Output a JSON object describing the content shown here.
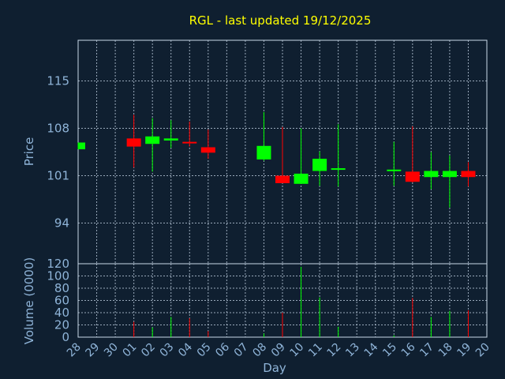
{
  "chart_data": {
    "type": "candlestick",
    "title": "RGL - last updated 19/12/2025",
    "xlabel": "Day",
    "ylabel_price": "Price",
    "ylabel_volume": "Volume (0000)",
    "x_tick_labels": [
      "28",
      "29",
      "30",
      "01",
      "02",
      "03",
      "04",
      "05",
      "06",
      "07",
      "08",
      "09",
      "10",
      "11",
      "12",
      "13",
      "14",
      "15",
      "16",
      "17",
      "18",
      "19",
      "20"
    ],
    "price_ticks": [
      "115",
      "108",
      "101",
      "94"
    ],
    "volume_ticks": [
      "0",
      "20",
      "40",
      "60",
      "80",
      "100",
      "120"
    ],
    "price_ylim": [
      88,
      121
    ],
    "volume_ylim": [
      0,
      120
    ],
    "grid": true,
    "colors": {
      "up": "#00ff00",
      "down": "#ff0000",
      "title": "#ffff00",
      "ticks": "#8fb4d8",
      "background": "#0f1f30"
    },
    "candles": [
      {
        "x": "28",
        "open": 104.9,
        "close": 105.9,
        "high": 105.9,
        "low": 104.9
      },
      {
        "x": "01",
        "open": 106.5,
        "close": 105.3,
        "high": 110.0,
        "low": 102.2
      },
      {
        "x": "02",
        "open": 105.7,
        "close": 106.8,
        "high": 109.5,
        "low": 101.6
      },
      {
        "x": "03",
        "open": 106.2,
        "close": 106.5,
        "high": 109.2,
        "low": 105.1
      },
      {
        "x": "04",
        "open": 106.0,
        "close": 105.8,
        "high": 109.0,
        "low": 105.3
      },
      {
        "x": "05",
        "open": 105.2,
        "close": 104.4,
        "high": 107.8,
        "low": 103.5
      },
      {
        "x": "08",
        "open": 103.4,
        "close": 105.4,
        "high": 110.4,
        "low": 103.2
      },
      {
        "x": "09",
        "open": 101.0,
        "close": 99.9,
        "high": 108.2,
        "low": 99.9
      },
      {
        "x": "10",
        "open": 99.8,
        "close": 101.3,
        "high": 108.0,
        "low": 99.8
      },
      {
        "x": "11",
        "open": 101.7,
        "close": 103.5,
        "high": 104.6,
        "low": 99.5
      },
      {
        "x": "12",
        "open": 101.9,
        "close": 102.1,
        "high": 108.6,
        "low": 99.4
      },
      {
        "x": "15",
        "open": 101.7,
        "close": 101.9,
        "high": 106.0,
        "low": 99.5
      },
      {
        "x": "16",
        "open": 101.6,
        "close": 100.1,
        "high": 108.3,
        "low": 100.0
      },
      {
        "x": "17",
        "open": 100.8,
        "close": 101.7,
        "high": 104.5,
        "low": 99.0
      },
      {
        "x": "18",
        "open": 100.8,
        "close": 101.7,
        "high": 104.0,
        "low": 96.3
      },
      {
        "x": "19",
        "open": 101.7,
        "close": 100.8,
        "high": 103.0,
        "low": 99.4
      }
    ],
    "volumes": [
      {
        "x": "28",
        "value": 0,
        "dir": "up"
      },
      {
        "x": "01",
        "value": 25,
        "dir": "down"
      },
      {
        "x": "02",
        "value": 16,
        "dir": "up"
      },
      {
        "x": "03",
        "value": 33,
        "dir": "up"
      },
      {
        "x": "04",
        "value": 31,
        "dir": "down"
      },
      {
        "x": "05",
        "value": 10,
        "dir": "down"
      },
      {
        "x": "08",
        "value": 6,
        "dir": "up"
      },
      {
        "x": "09",
        "value": 40,
        "dir": "down"
      },
      {
        "x": "10",
        "value": 115,
        "dir": "up"
      },
      {
        "x": "11",
        "value": 65,
        "dir": "up"
      },
      {
        "x": "12",
        "value": 17,
        "dir": "up"
      },
      {
        "x": "15",
        "value": 3,
        "dir": "up"
      },
      {
        "x": "16",
        "value": 64,
        "dir": "down"
      },
      {
        "x": "17",
        "value": 33,
        "dir": "up"
      },
      {
        "x": "18",
        "value": 43,
        "dir": "up"
      },
      {
        "x": "19",
        "value": 44,
        "dir": "down"
      }
    ]
  }
}
